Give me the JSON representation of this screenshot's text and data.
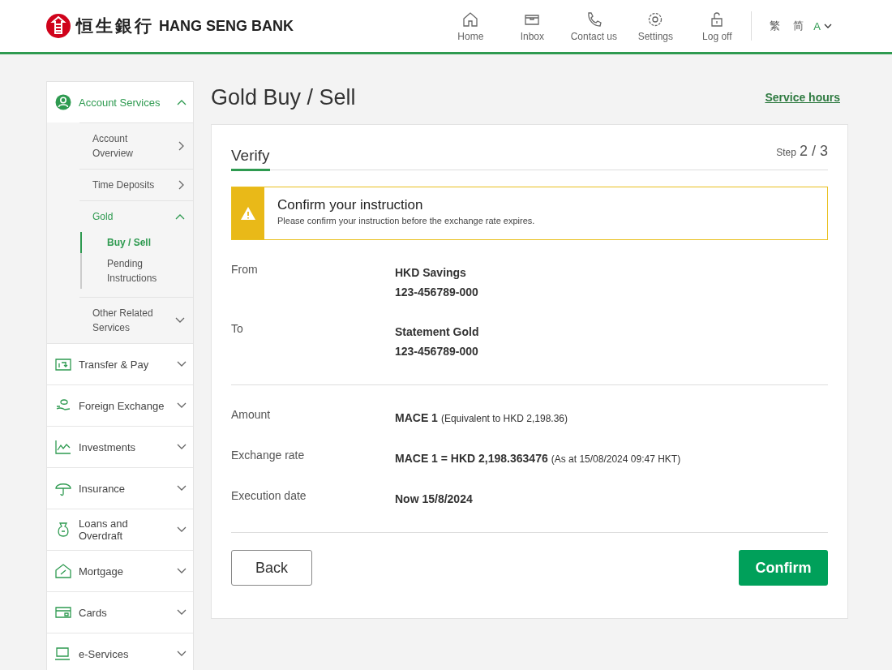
{
  "header": {
    "logo_chinese": "恒生銀行",
    "logo_english": "HANG SENG BANK",
    "nav": [
      {
        "label": "Home"
      },
      {
        "label": "Inbox"
      },
      {
        "label": "Contact us"
      },
      {
        "label": "Settings"
      },
      {
        "label": "Log off"
      }
    ],
    "languages": [
      "繁",
      "简"
    ],
    "font_size": "A"
  },
  "sidebar": {
    "sections": [
      {
        "label": "Account Services",
        "expanded": true,
        "children": [
          {
            "label": "Account Overview",
            "kind": "link"
          },
          {
            "label": "Time Deposits",
            "kind": "link"
          },
          {
            "label": "Gold",
            "kind": "group",
            "expanded": true,
            "children": [
              {
                "label": "Buy / Sell",
                "selected": true
              },
              {
                "label": "Pending Instructions",
                "selected": false
              }
            ]
          },
          {
            "label": "Other Related Services",
            "kind": "group",
            "expanded": false
          }
        ]
      },
      {
        "label": "Transfer & Pay",
        "expanded": false
      },
      {
        "label": "Foreign Exchange",
        "expanded": false
      },
      {
        "label": "Investments",
        "expanded": false
      },
      {
        "label": "Insurance",
        "expanded": false
      },
      {
        "label": "Loans and Overdraft",
        "expanded": false
      },
      {
        "label": "Mortgage",
        "expanded": false
      },
      {
        "label": "Cards",
        "expanded": false
      },
      {
        "label": "e-Services",
        "expanded": false
      }
    ]
  },
  "page": {
    "title": "Gold Buy / Sell",
    "service_hours": "Service hours",
    "tab": "Verify",
    "step_label": "Step",
    "step": "2 / 3",
    "alert": {
      "title": "Confirm your instruction",
      "message": "Please confirm your instruction before the exchange rate expires."
    },
    "groups": [
      [
        {
          "label": "From",
          "lines": [
            "HKD Savings",
            "123-456789-000"
          ]
        },
        {
          "label": "To",
          "lines": [
            "Statement Gold",
            "123-456789-000"
          ]
        }
      ],
      [
        {
          "label": "Amount",
          "lines": [
            "MACE 1"
          ],
          "note": "(Equivalent to HKD 2,198.36)"
        },
        {
          "label": "Exchange rate",
          "lines": [
            "MACE 1 = HKD 2,198.363476"
          ],
          "note": "(As at 15/08/2024 09:47 HKT)"
        },
        {
          "label": "Execution date",
          "lines": [
            "Now 15/8/2024"
          ]
        }
      ]
    ],
    "buttons": {
      "back": "Back",
      "confirm": "Confirm"
    }
  }
}
